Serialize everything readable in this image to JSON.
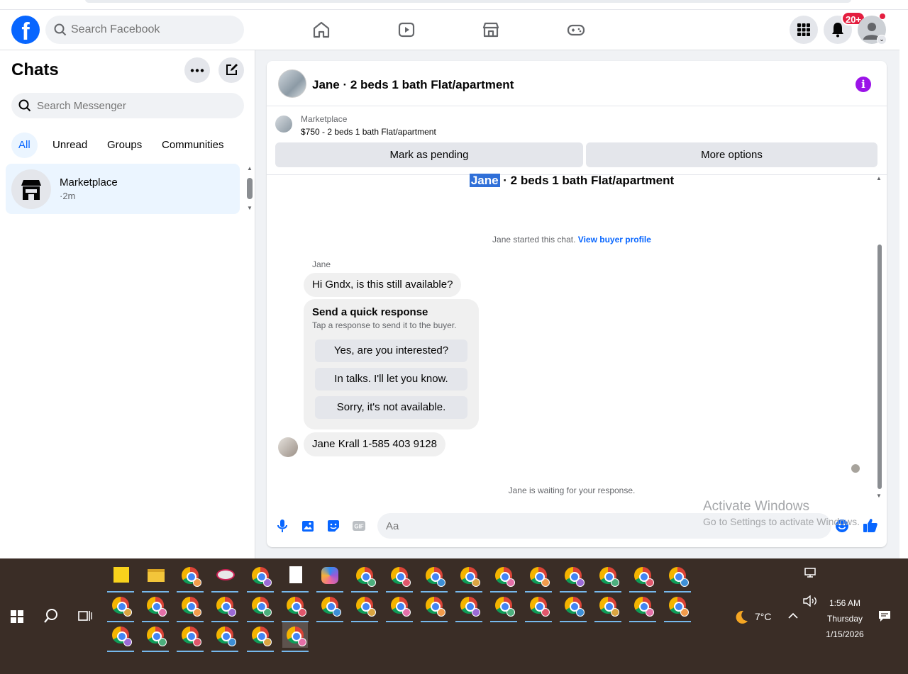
{
  "topnav": {
    "logo": "f",
    "search_placeholder": "Search Facebook",
    "notification_badge": "20+"
  },
  "sidebar": {
    "title": "Chats",
    "search_placeholder": "Search Messenger",
    "filters": [
      {
        "label": "All",
        "active": true
      },
      {
        "label": "Unread",
        "active": false
      },
      {
        "label": "Groups",
        "active": false
      },
      {
        "label": "Communities",
        "active": false
      }
    ],
    "chat_items": [
      {
        "name": "Marketplace",
        "time": "·2m",
        "icon": "marketplace-store-icon"
      }
    ]
  },
  "chat": {
    "header_title": "Jane · 2 beds 1 bath Flat/apartment",
    "listing": {
      "source": "Marketplace",
      "price_title": "$750 - 2 beds 1 bath Flat/apartment",
      "mark_pending_label": "Mark as pending",
      "more_options_label": "More options"
    },
    "thread_title_name": "Jane",
    "thread_title_rest": " · 2 beds 1 bath Flat/apartment",
    "started_text": "Jane started this chat. ",
    "view_buyer_profile": "View buyer profile",
    "sender_name": "Jane",
    "message1": "Hi Gndx, is this still available?",
    "quick_response": {
      "title": "Send a quick response",
      "subtitle": "Tap a response to send it to the buyer.",
      "options": [
        "Yes, are you interested?",
        "In talks. I'll let you know.",
        "Sorry, it's not available."
      ]
    },
    "message2": "Jane Krall 1-585 403 9128",
    "waiting_text": "Jane is waiting for your response.",
    "composer_placeholder": "Aa"
  },
  "watermark": {
    "title": "Activate Windows",
    "subtitle": "Go to Settings to activate Windows."
  },
  "taskbar": {
    "temperature": "7°C",
    "time": "1:56 AM",
    "day": "Thursday",
    "date": "1/15/2026"
  },
  "colors": {
    "facebook_blue": "#0866ff",
    "badge_red": "#e41e3f",
    "info_purple": "#9b13e8",
    "taskbar_bg": "#3a2d26"
  }
}
